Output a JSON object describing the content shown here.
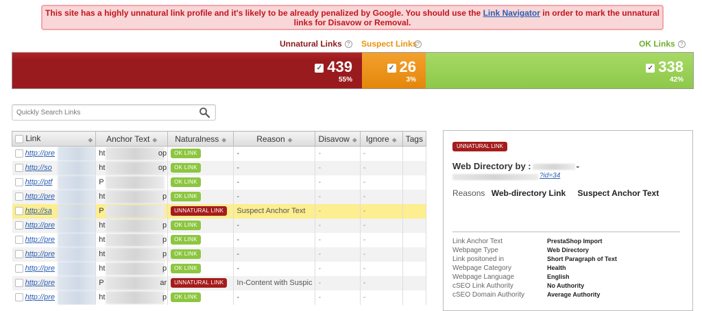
{
  "alert": {
    "text_before": "This site has a highly unnatural link profile and it's likely to be already penalized by Google. You should use the ",
    "link": "Link Navigator",
    "text_after": " in order to mark the unnatural links for Disavow or Removal."
  },
  "legend": {
    "unnatural": "Unnatural Links",
    "suspect": "Suspect Links",
    "ok": "OK Links",
    "help": "?"
  },
  "bar": {
    "unnatural": {
      "count": "439",
      "percent": "55%",
      "color": "#9a1b1d"
    },
    "suspect": {
      "count": "26",
      "percent": "3%",
      "color": "#e3870b"
    },
    "ok": {
      "count": "338",
      "percent": "42%",
      "color": "#8ec84a"
    },
    "check": "✓"
  },
  "search": {
    "placeholder": "Quickly Search Links",
    "icon": "search-icon"
  },
  "table": {
    "headers": [
      "Link",
      "Anchor Text",
      "Naturalness",
      "Reason",
      "Disavow",
      "Ignore",
      "Tags"
    ],
    "rows": [
      {
        "link": "http://pre",
        "anchor": "ht",
        "anchor_tail": "op",
        "tag": "OK LINK",
        "reason": "-",
        "disavow": "-",
        "ignore": "-"
      },
      {
        "link": "http://so",
        "anchor": "ht",
        "anchor_tail": "op",
        "tag": "OK LINK",
        "reason": "-",
        "disavow": "-",
        "ignore": "-"
      },
      {
        "link": "http://ptf",
        "anchor": "P",
        "anchor_tail": "",
        "tag": "OK LINK",
        "reason": "-",
        "disavow": "-",
        "ignore": "-"
      },
      {
        "link": "http://pre",
        "anchor": "ht",
        "anchor_tail": "p",
        "tag": "OK LINK",
        "reason": "-",
        "disavow": "-",
        "ignore": "-"
      },
      {
        "link": "http://sa",
        "anchor": "P",
        "anchor_tail": "",
        "tag": "UNNATURAL LINK",
        "reason": "Suspect Anchor Text",
        "disavow": "-",
        "ignore": "-"
      },
      {
        "link": "http://pre",
        "anchor": "ht",
        "anchor_tail": "p",
        "tag": "OK LINK",
        "reason": "-",
        "disavow": "-",
        "ignore": "-"
      },
      {
        "link": "http://pre",
        "anchor": "ht",
        "anchor_tail": "p",
        "tag": "OK LINK",
        "reason": "-",
        "disavow": "-",
        "ignore": "-"
      },
      {
        "link": "http://pre",
        "anchor": "ht",
        "anchor_tail": "p",
        "tag": "OK LINK",
        "reason": "-",
        "disavow": "-",
        "ignore": "-"
      },
      {
        "link": "http://pre",
        "anchor": "ht",
        "anchor_tail": "p",
        "tag": "OK LINK",
        "reason": "-",
        "disavow": "-",
        "ignore": "-"
      },
      {
        "link": "http://pre",
        "anchor": "P",
        "anchor_tail": "ar",
        "tag": "UNNATURAL LINK",
        "reason": "In-Content with Suspic",
        "disavow": "-",
        "ignore": "-"
      },
      {
        "link": "http://pre",
        "anchor": "ht",
        "anchor_tail": "p",
        "tag": "OK LINK",
        "reason": "-",
        "disavow": "-",
        "ignore": "-"
      }
    ]
  },
  "panel": {
    "tag": "UNNATURAL LINK",
    "title": "Web Directory by :",
    "title_tail": "-",
    "url": "?id=34",
    "reasons_label": "Reasons",
    "reasons": [
      "Web-directory Link",
      "Suspect Anchor Text"
    ],
    "details": [
      {
        "label": "Link Anchor Text",
        "value": "PrestaShop Import"
      },
      {
        "label": "Webpage Type",
        "value": "Web Directory"
      },
      {
        "label": "Link positoned in",
        "value": "Short Paragraph of Text"
      },
      {
        "label": "Webpage Category",
        "value": "Health"
      },
      {
        "label": "Webpage Language",
        "value": "English"
      },
      {
        "label": "cSEO Link Authority",
        "value": "No Authority"
      },
      {
        "label": "cSEO Domain Authority",
        "value": "Average Authority"
      }
    ]
  }
}
